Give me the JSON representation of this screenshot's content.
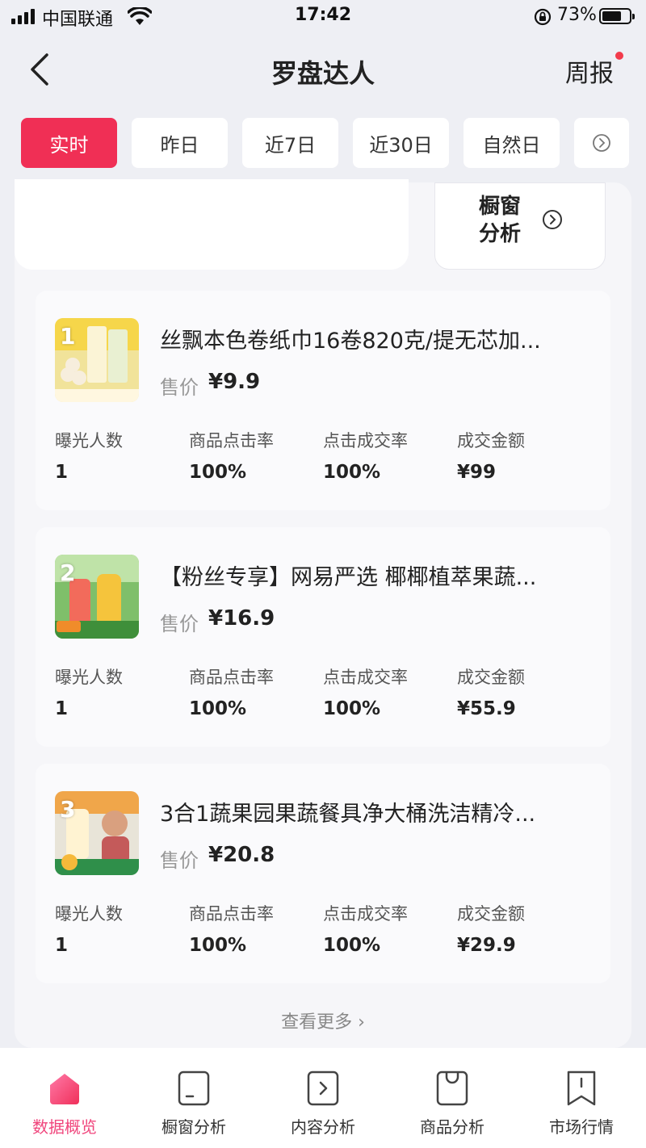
{
  "status_bar": {
    "carrier": "中国联通",
    "time": "17:42",
    "battery": "73%",
    "battery_level": 0.73
  },
  "nav": {
    "title": "罗盘达人",
    "weekly_label": "周报"
  },
  "tabs": [
    {
      "label": "实时",
      "active": true
    },
    {
      "label": "昨日",
      "active": false
    },
    {
      "label": "近7日",
      "active": false
    },
    {
      "label": "近30日",
      "active": false
    },
    {
      "label": "自然日",
      "active": false
    }
  ],
  "window_analysis_card": {
    "label": "橱窗分析"
  },
  "metric_labels": [
    "曝光人数",
    "商品点击率",
    "点击成交率",
    "成交金额"
  ],
  "price_label": "售价",
  "products": [
    {
      "rank": "1",
      "name": "丝飘本色卷纸巾16卷820克/提无芯加...",
      "price": "¥9.9",
      "metrics": [
        "1",
        "100%",
        "100%",
        "¥99"
      ]
    },
    {
      "rank": "2",
      "name": "【粉丝专享】网易严选 椰椰植萃果蔬...",
      "price": "¥16.9",
      "metrics": [
        "1",
        "100%",
        "100%",
        "¥55.9"
      ]
    },
    {
      "rank": "3",
      "name": "3合1蔬果园果蔬餐具净大桶洗洁精冷...",
      "price": "¥20.8",
      "metrics": [
        "1",
        "100%",
        "100%",
        "¥29.9"
      ]
    }
  ],
  "see_more": "查看更多 ›",
  "bottom_tabs": [
    {
      "label": "数据概览",
      "icon": "home-icon",
      "active": true
    },
    {
      "label": "橱窗分析",
      "icon": "window-icon",
      "active": false
    },
    {
      "label": "内容分析",
      "icon": "play-icon",
      "active": false
    },
    {
      "label": "商品分析",
      "icon": "bag-icon",
      "active": false
    },
    {
      "label": "市场行情",
      "icon": "bookmark-icon",
      "active": false
    }
  ],
  "colors": {
    "accent": "#f02f55",
    "active_tab_label": "#f0457c",
    "background": "#eeeff4"
  }
}
